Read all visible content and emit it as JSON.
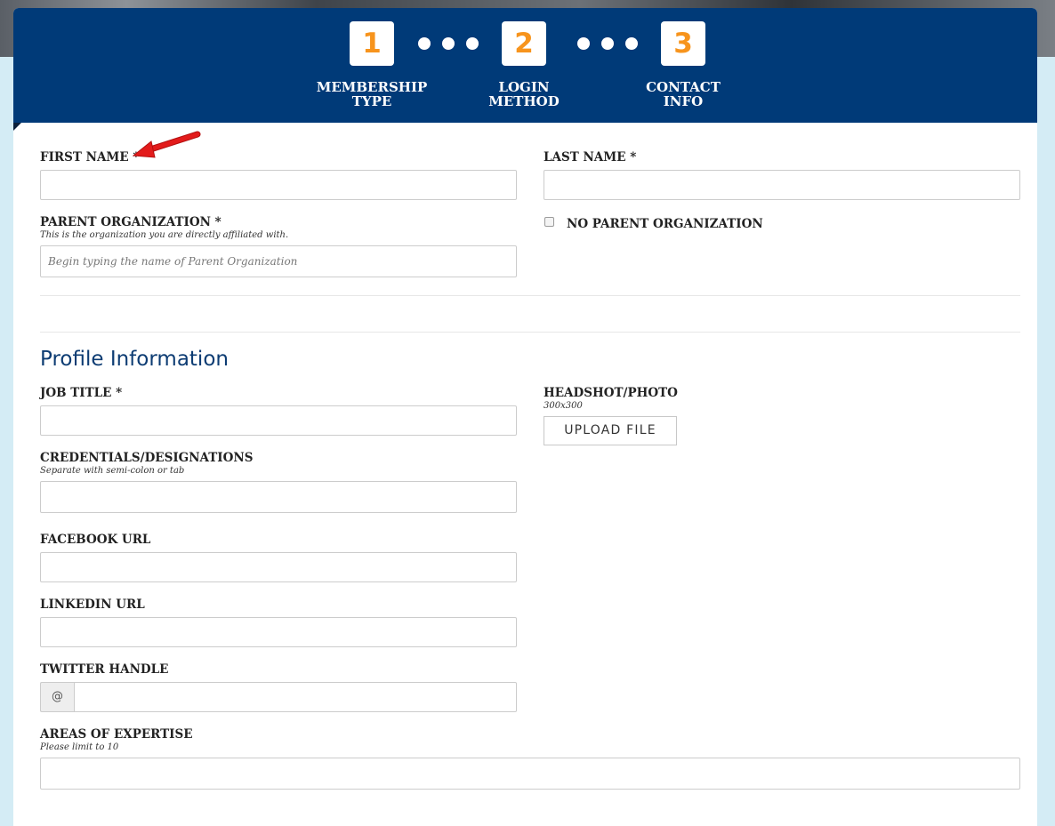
{
  "steps": [
    {
      "number": "1",
      "label": "MEMBERSHIP TYPE"
    },
    {
      "number": "2",
      "label": "LOGIN METHOD"
    },
    {
      "number": "3",
      "label": "CONTACT INFO"
    }
  ],
  "colors": {
    "header_bg": "#003a78",
    "step_number": "#f7941d",
    "section_title": "#0d3c73",
    "page_bg": "#d4ecf5",
    "arrow": "#e31b1b"
  },
  "form": {
    "first_name": {
      "label": "FIRST NAME *",
      "value": "",
      "placeholder": ""
    },
    "last_name": {
      "label": "LAST NAME *",
      "value": "",
      "placeholder": ""
    },
    "parent_org": {
      "label": "PARENT ORGANIZATION *",
      "hint": "This is the organization you are directly affiliated with.",
      "placeholder": "Begin typing the name of Parent Organization",
      "value": ""
    },
    "no_parent_org": {
      "label": "NO PARENT ORGANIZATION",
      "checked": false
    }
  },
  "profile": {
    "title": "Profile Information",
    "job_title": {
      "label": "JOB TITLE *",
      "value": ""
    },
    "headshot": {
      "label": "HEADSHOT/PHOTO",
      "hint": "300x300",
      "button": "UPLOAD FILE"
    },
    "credentials": {
      "label": "CREDENTIALS/DESIGNATIONS",
      "hint": "Separate with semi-colon or tab",
      "value": ""
    },
    "facebook": {
      "label": "FACEBOOK URL",
      "value": ""
    },
    "linkedin": {
      "label": "LINKEDIN URL",
      "value": ""
    },
    "twitter": {
      "label": "TWITTER HANDLE",
      "prefix": "@",
      "value": ""
    },
    "expertise": {
      "label": "AREAS OF EXPERTISE",
      "hint": "Please limit to 10",
      "value": ""
    }
  },
  "icons": {
    "annotation": "red-arrow-icon"
  }
}
